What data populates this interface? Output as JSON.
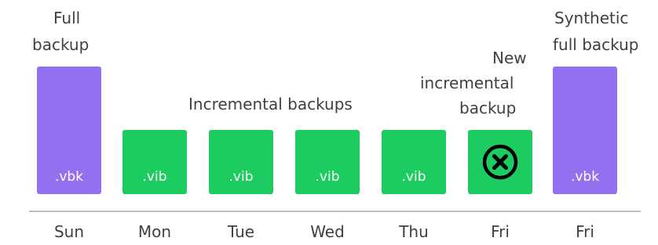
{
  "colors": {
    "full_backup": "#9370f0",
    "incremental_backup": "#1dcc60",
    "failure_icon": "#000000"
  },
  "labels": {
    "full_backup_line1": "Full",
    "full_backup_line2": "backup",
    "incremental_backups": "Incremental backups",
    "new_incremental_line1": "New",
    "new_incremental_line2": "incremental",
    "new_incremental_line3": "backup",
    "synthetic_line1": "Synthetic",
    "synthetic_line2": "full backup"
  },
  "boxes": [
    {
      "day": "Sun",
      "type": "full",
      "ext": ".vbk"
    },
    {
      "day": "Mon",
      "type": "incremental",
      "ext": ".vib"
    },
    {
      "day": "Tue",
      "type": "incremental",
      "ext": ".vib"
    },
    {
      "day": "Wed",
      "type": "incremental",
      "ext": ".vib"
    },
    {
      "day": "Thu",
      "type": "incremental",
      "ext": ".vib"
    },
    {
      "day": "Fri",
      "type": "incremental-failed",
      "icon": "x-circle-icon"
    },
    {
      "day": "Fri",
      "type": "synthetic-full",
      "ext": ".vbk"
    }
  ]
}
